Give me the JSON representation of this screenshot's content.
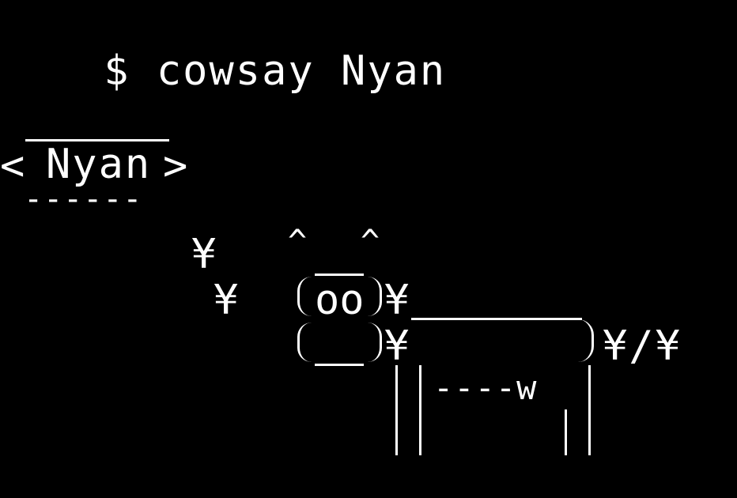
{
  "terminal": {
    "prompt": "$",
    "command": "cowsay Nyan"
  },
  "bubble": {
    "left": "<",
    "text": "Nyan",
    "right": ">",
    "underline": "------"
  },
  "cow": {
    "tail1": "¥",
    "tail2": "¥",
    "ear_left": "^",
    "ear_right": "^",
    "eyes": "oo",
    "head_mark_upper": "¥",
    "head_mark_lower": "¥",
    "tail_end": "¥/¥",
    "udder": "----w"
  },
  "colors": {
    "background": "#000000",
    "text": "#ffffff"
  }
}
